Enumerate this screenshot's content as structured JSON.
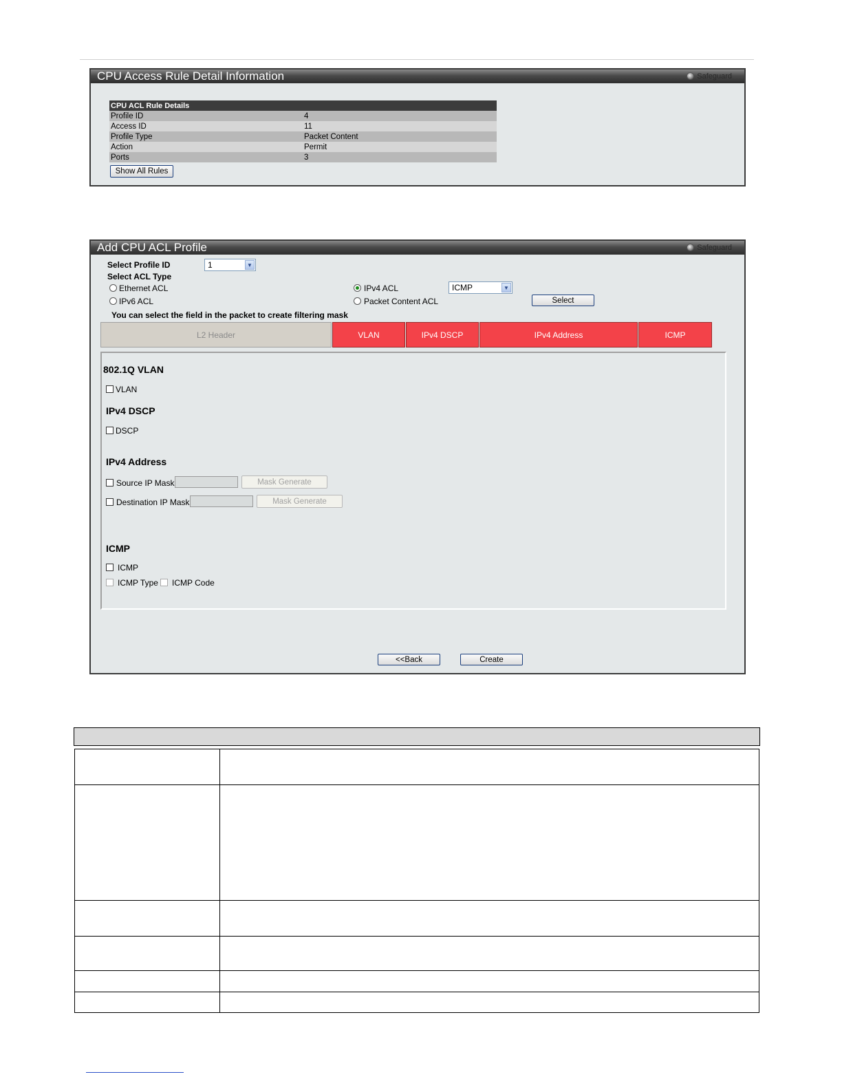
{
  "detail_panel": {
    "title": "CPU Access Rule Detail Information",
    "safeguard": "Safeguard",
    "table_header": "CPU ACL Rule Details",
    "rows": [
      {
        "label": "Profile  ID",
        "value": "4"
      },
      {
        "label": "Access ID",
        "value": "11"
      },
      {
        "label": "Profile Type",
        "value": "Packet Content"
      },
      {
        "label": "Action",
        "value": "Permit"
      },
      {
        "label": "Ports",
        "value": "3"
      }
    ],
    "show_all_label": "Show All Rules"
  },
  "add_panel": {
    "title": "Add CPU ACL Profile",
    "safeguard": "Safeguard",
    "select_profile_label": "Select Profile ID",
    "profile_id_value": "1",
    "select_acl_type_label": "Select ACL Type",
    "radios": {
      "ethernet": "Ethernet ACL",
      "ipv6": "IPv6 ACL",
      "ipv4": "IPv4 ACL",
      "packet_content": "Packet Content ACL"
    },
    "ipv4_protocol_value": "ICMP",
    "select_button": "Select",
    "hint": "You can select the field in the packet to create filtering mask",
    "tabs": {
      "l2": "L2 Header",
      "vlan": "VLAN",
      "dscp": "IPv4 DSCP",
      "address": "IPv4 Address",
      "icmp": "ICMP"
    },
    "sections": {
      "vlan_title": "802.1Q VLAN",
      "vlan_cb": "VLAN",
      "dscp_title": "IPv4 DSCP",
      "dscp_cb": "DSCP",
      "addr_title": "IPv4 Address",
      "src_mask": "Source IP Mask",
      "dst_mask": "Destination IP Mask",
      "mask_generate": "Mask Generate",
      "icmp_title": "ICMP",
      "icmp_cb": "ICMP",
      "icmp_type": "ICMP Type",
      "icmp_code": "ICMP Code"
    },
    "back_button": "<<Back",
    "create_button": "Create"
  },
  "colors": {
    "tab_active": "#f34249",
    "panel_bg": "#e4e8e9"
  }
}
